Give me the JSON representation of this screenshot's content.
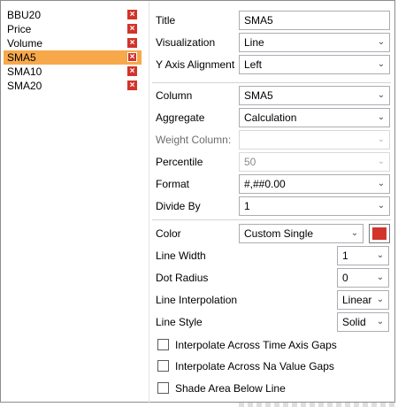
{
  "series": [
    {
      "label": "BBU20",
      "selected": false
    },
    {
      "label": "Price",
      "selected": false
    },
    {
      "label": "Volume",
      "selected": false
    },
    {
      "label": "SMA5",
      "selected": true
    },
    {
      "label": "SMA10",
      "selected": false
    },
    {
      "label": "SMA20",
      "selected": false
    }
  ],
  "delete_glyph": "×",
  "chevron_glyph": "⌄",
  "properties": {
    "title": {
      "label": "Title",
      "value": "SMA5"
    },
    "visualization": {
      "label": "Visualization",
      "value": "Line"
    },
    "y_axis_alignment": {
      "label": "Y Axis Alignment",
      "value": "Left"
    },
    "column": {
      "label": "Column",
      "value": "SMA5"
    },
    "aggregate": {
      "label": "Aggregate",
      "value": "Calculation"
    },
    "weight_column": {
      "label": "Weight Column:",
      "value": ""
    },
    "percentile": {
      "label": "Percentile",
      "value": "50"
    },
    "format": {
      "label": "Format",
      "value": "#,##0.00"
    },
    "divide_by": {
      "label": "Divide By",
      "value": "1"
    },
    "color": {
      "label": "Color",
      "value": "Custom Single",
      "swatch": "#d2342b"
    },
    "line_width": {
      "label": "Line Width",
      "value": "1"
    },
    "dot_radius": {
      "label": "Dot Radius",
      "value": "0"
    },
    "line_interpolation": {
      "label": "Line Interpolation",
      "value": "Linear"
    },
    "line_style": {
      "label": "Line Style",
      "value": "Solid"
    }
  },
  "checkboxes": [
    {
      "label": "Interpolate Across Time Axis Gaps",
      "checked": false
    },
    {
      "label": "Interpolate Across Na Value Gaps",
      "checked": false
    },
    {
      "label": "Shade Area Below Line",
      "checked": false
    }
  ],
  "colors": {
    "selected_row": "#f7a84a",
    "delete_button": "#d2342b",
    "border": "#abadb3"
  }
}
